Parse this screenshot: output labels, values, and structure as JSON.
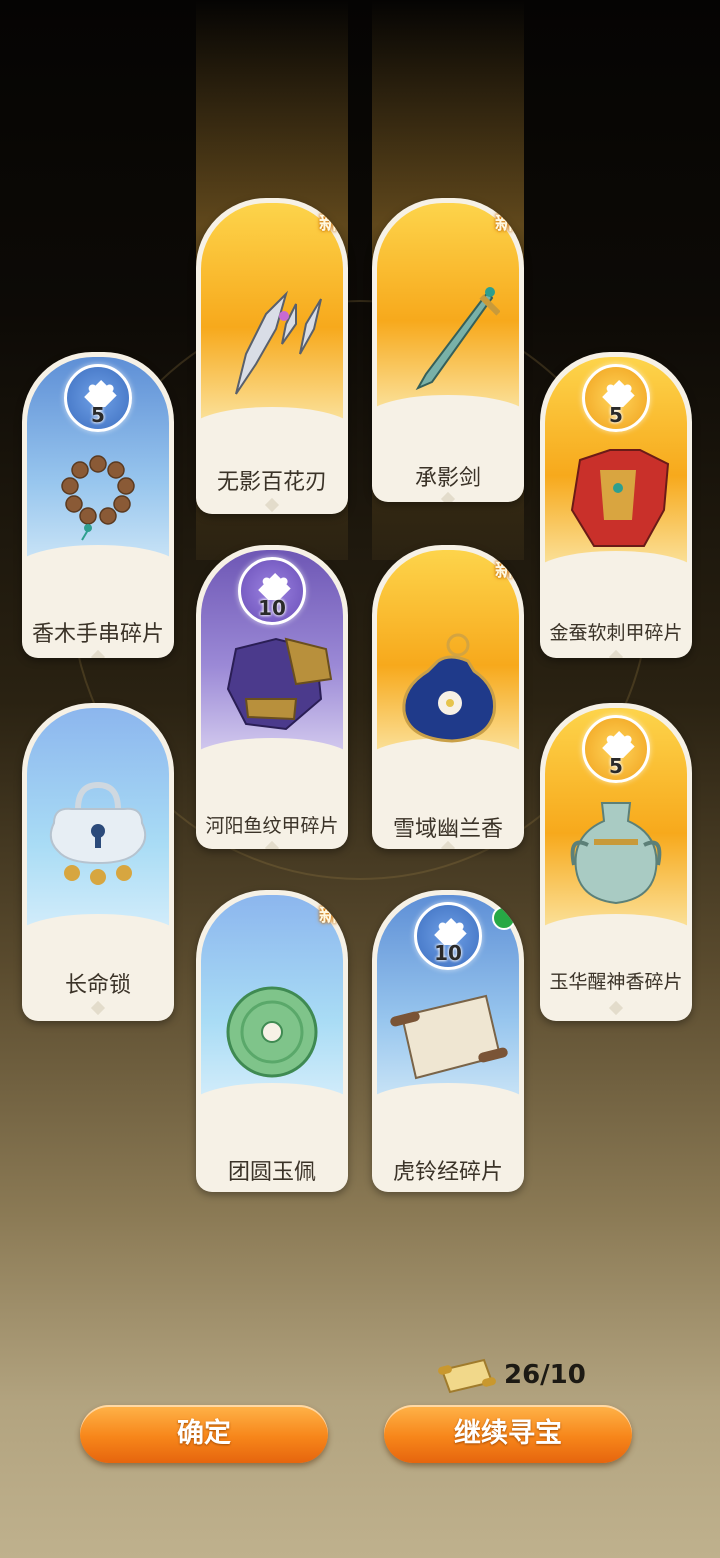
{
  "cards": [
    {
      "name": "香木手串碎片",
      "count": "5"
    },
    {
      "name": "长命锁"
    },
    {
      "name": "无影百花刃",
      "tag": "新"
    },
    {
      "name": "河阳鱼纹甲碎片",
      "count": "10"
    },
    {
      "name": "团圆玉佩",
      "tag": "新"
    },
    {
      "name": "承影剑",
      "tag": "新"
    },
    {
      "name": "雪域幽兰香",
      "tag": "新"
    },
    {
      "name": "虎铃经碎片",
      "count": "10"
    },
    {
      "name": "金蚕软刺甲碎片",
      "count": "5"
    },
    {
      "name": "玉华醒神香碎片",
      "count": "5"
    }
  ],
  "ticket_count": "26/10",
  "buttons": {
    "confirm": "确定",
    "continue": "继续寻宝"
  },
  "colors": {
    "gold": "#f7a91c",
    "blue": "#5e8fd6",
    "purple": "#6e57b5",
    "button": "#f7861a"
  }
}
